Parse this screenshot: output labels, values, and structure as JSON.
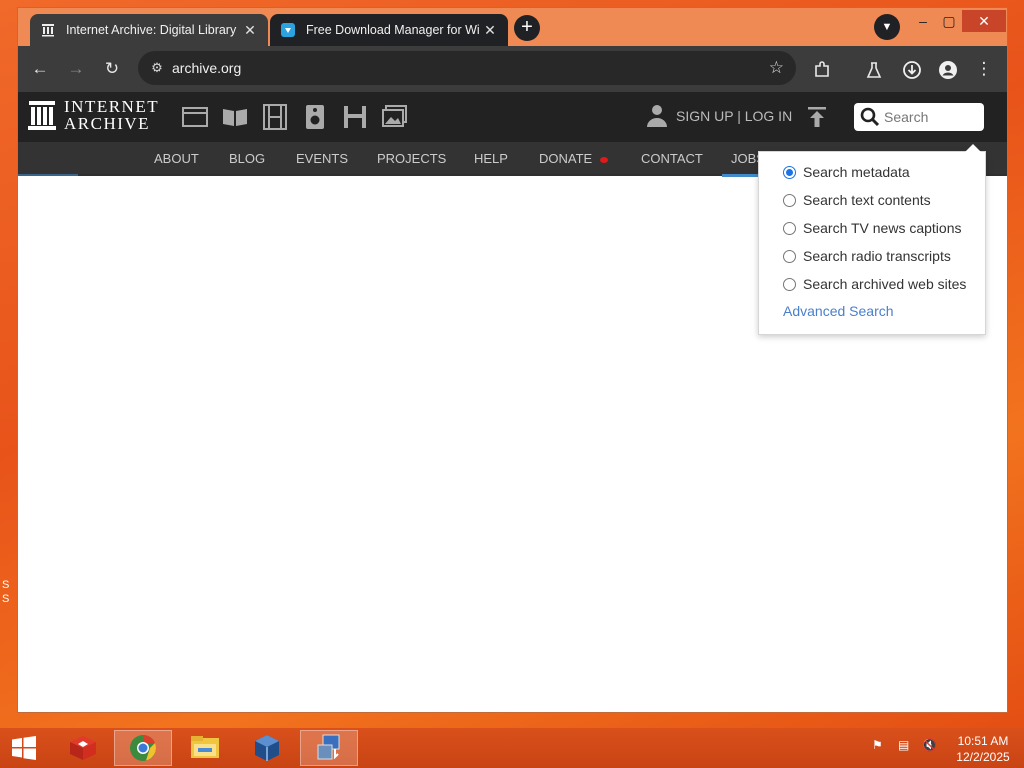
{
  "browser": {
    "tabs": [
      {
        "title": "Internet Archive: Digital Library",
        "active": true
      },
      {
        "title": "Free Download Manager for Wi",
        "active": false
      }
    ],
    "new_tab_label": "+",
    "url": "archive.org"
  },
  "ia": {
    "logo_line1": "INTERNET",
    "logo_line2": "ARCHIVE",
    "auth_text": "SIGN UP | LOG IN",
    "search_placeholder": "Search",
    "nav": [
      "ABOUT",
      "BLOG",
      "EVENTS",
      "PROJECTS",
      "HELP",
      "DONATE",
      "CONTACT",
      "JOBS"
    ],
    "search_options": [
      {
        "label": "Search metadata",
        "checked": true
      },
      {
        "label": "Search text contents",
        "checked": false
      },
      {
        "label": "Search TV news captions",
        "checked": false
      },
      {
        "label": "Search radio transcripts",
        "checked": false
      },
      {
        "label": "Search archived web sites",
        "checked": false
      }
    ],
    "advanced_search": "Advanced Search",
    "colors": {
      "header": "#222222",
      "nav": "#333333",
      "link": "#4a7fcb",
      "donate_dot": "#e01a1a"
    }
  },
  "taskbar": {
    "time": "10:51 AM",
    "date": "12/2/2025"
  },
  "desktop": {
    "letters": [
      "S",
      "S"
    ]
  }
}
